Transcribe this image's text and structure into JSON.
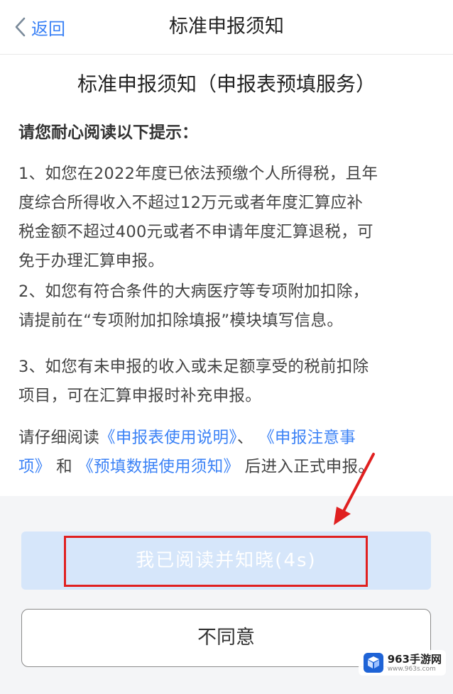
{
  "nav": {
    "back_label": "返回",
    "title": "标准申报须知"
  },
  "doc": {
    "title": "标准申报须知（申报表预填服务）",
    "intro": "请您耐心阅读以下提示：",
    "p1_lines": [
      "1、如您在2022年度已依法预缴个人所得税，且年",
      "度综合所得收入不超过12万元或者年度汇算应补",
      "税金额不超过400元或者不申请年度汇算退税，可",
      "免于办理汇算申报。"
    ],
    "p2_lines": [
      "2、如您有符合条件的大病医疗等专项附加扣除，",
      "请提前在“专项附加扣除填报”模块填写信息。"
    ],
    "p3_lines": [
      "3、如您有未申报的收入或未足额享受的税前扣除",
      "项目，可在汇算申报时补充申报。"
    ],
    "p4": {
      "prefix": "请仔细阅读",
      "link1": "《申报表使用说明》",
      "sep1": "、",
      "link2a": "《申报注意事",
      "link2b": "项》",
      "sep2": "和",
      "link3": "《预填数据使用须知》",
      "suffix": "后进入正式申报。"
    }
  },
  "buttons": {
    "confirm_label": "我已阅读并知晓(4s)",
    "disagree_label": "不同意"
  },
  "watermark": {
    "name": "963手游网",
    "url": "www.963s.com"
  },
  "colors": {
    "link": "#3b82f6",
    "confirm_bg": "#d6e6fa",
    "annotation_red": "#e02020",
    "bottom_bg": "#f4f5f7"
  }
}
